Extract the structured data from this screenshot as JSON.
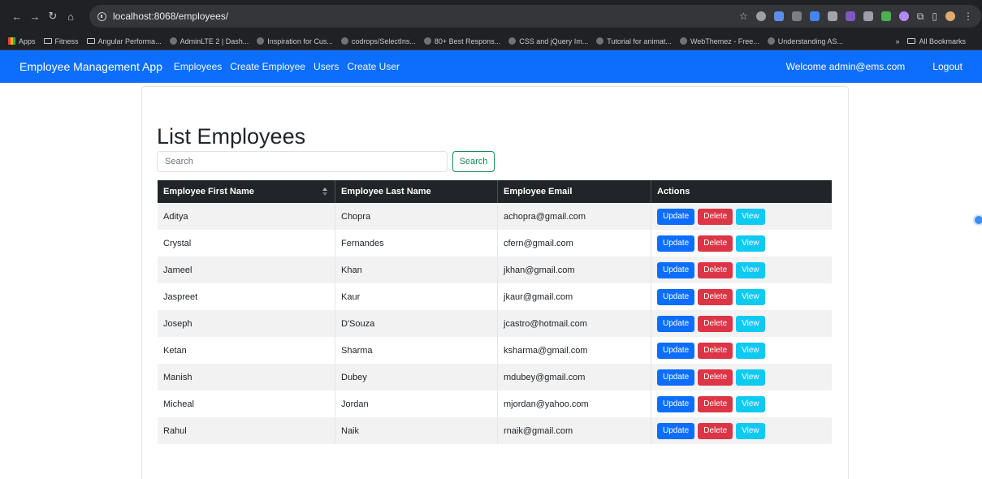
{
  "browser": {
    "url": "localhost:8068/employees/",
    "bookmarks": [
      "Apps",
      "Fitness",
      "Angular Performa...",
      "AdminLTE 2 | Dash...",
      "Inspiration for Cus...",
      "codrops/SelectIns...",
      "80+ Best Respons...",
      "CSS and jQuery Im...",
      "Tutorial for animat...",
      "WebThemez - Free...",
      "Understanding AS..."
    ],
    "all_bookmarks": "All Bookmarks",
    "more": "»"
  },
  "navbar": {
    "brand": "Employee Management App",
    "links": [
      "Employees",
      "Create Employee",
      "Users",
      "Create User"
    ],
    "welcome": "Welcome admin@ems.com",
    "logout": "Logout"
  },
  "page": {
    "title": "List Employees",
    "search_placeholder": "Search",
    "search_button": "Search"
  },
  "table": {
    "headers": [
      "Employee First Name",
      "Employee Last Name",
      "Employee Email",
      "Actions"
    ],
    "rows": [
      {
        "first": "Aditya",
        "last": "Chopra",
        "email": "achopra@gmail.com"
      },
      {
        "first": "Crystal",
        "last": "Fernandes",
        "email": "cfern@gmail.com"
      },
      {
        "first": "Jameel",
        "last": "Khan",
        "email": "jkhan@gmail.com"
      },
      {
        "first": "Jaspreet",
        "last": "Kaur",
        "email": "jkaur@gmail.com"
      },
      {
        "first": "Joseph",
        "last": "D'Souza",
        "email": "jcastro@hotmail.com"
      },
      {
        "first": "Ketan",
        "last": "Sharma",
        "email": "ksharma@gmail.com"
      },
      {
        "first": "Manish",
        "last": "Dubey",
        "email": "mdubey@gmail.com"
      },
      {
        "first": "Micheal",
        "last": "Jordan",
        "email": "mjordan@yahoo.com"
      },
      {
        "first": "Rahul",
        "last": "Naik",
        "email": "rnaik@gmail.com"
      }
    ],
    "actions": {
      "update": "Update",
      "delete": "Delete",
      "view": "View"
    }
  },
  "colors": {
    "primary": "#0d6efd",
    "danger": "#dc3545",
    "info": "#0dcaf0",
    "success": "#198754",
    "dark": "#212529"
  }
}
